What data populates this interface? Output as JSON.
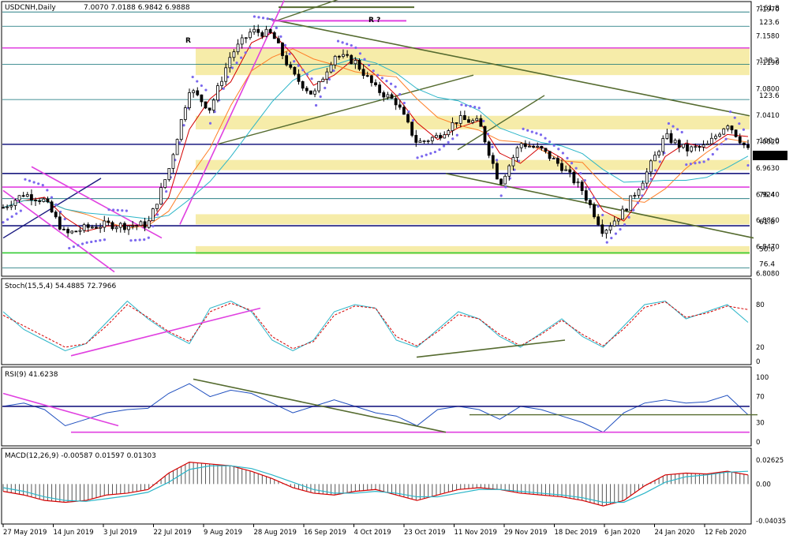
{
  "window": {
    "symbol": "USDCNH,Daily",
    "ohlc": "7.0070 7.0188 6.9842 6.9888"
  },
  "colors": {
    "background": "#ffffff",
    "candle": "#000000",
    "ma_fast": "#d40000",
    "ma_mid": "#ff7f27",
    "ma_slow": "#2bb5c8",
    "parabolic_sar": "#7b68ee",
    "zone_fill": "#f5e99a",
    "magenta": "#e040e0",
    "navy": "#1a1a80",
    "olive": "#556b2f",
    "green": "#33cc33",
    "teal": "#0a6e74",
    "annotation": "#a0522d",
    "stoch_main": "#2bb5c8",
    "stoch_signal": "#d40000",
    "rsi": "#1f4fbf",
    "macd_line": "#d40000",
    "macd_signal": "#2bb5c8",
    "macd_hist": "#555555"
  },
  "annotations": [
    "R",
    "R ?"
  ],
  "chart_data": [
    {
      "type": "candlestick",
      "title": "USDCNH,Daily",
      "ylim": [
        6.806,
        7.206
      ],
      "y_ticks": [
        "7.1970",
        "7.1580",
        "7.1190",
        "7.0800",
        "7.0410",
        "7.0020",
        "6.9630",
        "6.9240",
        "6.8860",
        "6.8470",
        "6.8080"
      ],
      "current_price": "6.9888",
      "fib_labels": [
        {
          "text": "161.8",
          "value": 7.193
        },
        {
          "text": "123.6",
          "value": 7.172
        },
        {
          "text": "138.2",
          "value": 7.116
        },
        {
          "text": "123.6",
          "value": 7.064
        },
        {
          "text": "100.0",
          "value": 6.998
        },
        {
          "text": "76.4",
          "value": 6.918
        },
        {
          "text": "61.8",
          "value": 6.878
        },
        {
          "text": "50.0",
          "value": 6.838
        },
        {
          "text": "76.4",
          "value": 6.816
        }
      ],
      "x_labels": [
        "27 May 2019",
        "14 Jun 2019",
        "3 Jul 2019",
        "22 Jul 2019",
        "9 Aug 2019",
        "28 Aug 2019",
        "16 Sep 2019",
        "4 Oct 2019",
        "23 Oct 2019",
        "11 Nov 2019",
        "29 Nov 2019",
        "18 Dec 2019",
        "6 Jan 2020",
        "24 Jan 2020",
        "12 Feb 2020"
      ],
      "close_path": [
        {
          "d": "27 May 2019",
          "c": 6.905
        },
        {
          "d": "5 Jun 2019",
          "c": 6.925
        },
        {
          "d": "14 Jun 2019",
          "c": 6.915
        },
        {
          "d": "20 Jun 2019",
          "c": 6.865
        },
        {
          "d": "25 Jun 2019",
          "c": 6.875
        },
        {
          "d": "3 Jul 2019",
          "c": 6.88
        },
        {
          "d": "12 Jul 2019",
          "c": 6.878
        },
        {
          "d": "22 Jul 2019",
          "c": 6.88
        },
        {
          "d": "2 Aug 2019",
          "c": 6.96
        },
        {
          "d": "9 Aug 2019",
          "c": 7.08
        },
        {
          "d": "16 Aug 2019",
          "c": 7.05
        },
        {
          "d": "23 Aug 2019",
          "c": 7.13
        },
        {
          "d": "28 Aug 2019",
          "c": 7.165
        },
        {
          "d": "3 Sep 2019",
          "c": 7.16
        },
        {
          "d": "9 Sep 2019",
          "c": 7.1
        },
        {
          "d": "16 Sep 2019",
          "c": 7.07
        },
        {
          "d": "25 Sep 2019",
          "c": 7.13
        },
        {
          "d": "4 Oct 2019",
          "c": 7.12
        },
        {
          "d": "14 Oct 2019",
          "c": 7.08
        },
        {
          "d": "23 Oct 2019",
          "c": 7.06
        },
        {
          "d": "31 Oct 2019",
          "c": 7.0
        },
        {
          "d": "11 Nov 2019",
          "c": 7.01
        },
        {
          "d": "20 Nov 2019",
          "c": 7.035
        },
        {
          "d": "29 Nov 2019",
          "c": 7.03
        },
        {
          "d": "3 Dec 2019",
          "c": 6.94
        },
        {
          "d": "10 Dec 2019",
          "c": 7.0
        },
        {
          "d": "18 Dec 2019",
          "c": 6.99
        },
        {
          "d": "27 Dec 2019",
          "c": 6.965
        },
        {
          "d": "6 Jan 2020",
          "c": 6.93
        },
        {
          "d": "14 Jan 2020",
          "c": 6.87
        },
        {
          "d": "20 Jan 2020",
          "c": 6.9
        },
        {
          "d": "24 Jan 2020",
          "c": 6.95
        },
        {
          "d": "3 Feb 2020",
          "c": 7.01
        },
        {
          "d": "7 Feb 2020",
          "c": 6.99
        },
        {
          "d": "12 Feb 2020",
          "c": 6.995
        },
        {
          "d": "17 Feb 2020",
          "c": 7.03
        },
        {
          "d": "21 Feb 2020",
          "c": 6.989
        }
      ]
    },
    {
      "type": "line",
      "title": "Stoch(15,5,4) 54.4885 72.7966",
      "ylim": [
        0,
        100
      ],
      "y_ticks": [
        "80",
        "20",
        "0"
      ],
      "series": [
        {
          "name": "main",
          "values": [
            70,
            45,
            30,
            15,
            25,
            55,
            85,
            60,
            40,
            25,
            75,
            85,
            70,
            30,
            15,
            30,
            70,
            80,
            75,
            30,
            20,
            45,
            70,
            60,
            35,
            20,
            40,
            60,
            35,
            20,
            50,
            80,
            85,
            60,
            70,
            80,
            55
          ]
        },
        {
          "name": "signal",
          "values": [
            65,
            50,
            35,
            20,
            25,
            50,
            80,
            62,
            42,
            28,
            70,
            82,
            72,
            35,
            18,
            28,
            65,
            78,
            75,
            35,
            22,
            42,
            66,
            60,
            38,
            22,
            38,
            58,
            38,
            22,
            46,
            76,
            84,
            62,
            68,
            78,
            73
          ]
        }
      ]
    },
    {
      "type": "line",
      "title": "RSI(9) 41.6238",
      "ylim": [
        0,
        100
      ],
      "y_ticks": [
        "100",
        "70",
        "30",
        "0"
      ],
      "series": [
        {
          "name": "rsi",
          "values": [
            55,
            60,
            50,
            25,
            35,
            45,
            50,
            52,
            75,
            90,
            70,
            80,
            75,
            60,
            45,
            55,
            65,
            55,
            45,
            40,
            25,
            50,
            55,
            50,
            35,
            55,
            50,
            40,
            30,
            15,
            45,
            60,
            65,
            60,
            62,
            72,
            42
          ]
        }
      ]
    },
    {
      "type": "bar",
      "title": "MACD(12,26,9) -0.00587 0.01597 0.01303",
      "ylim": [
        -0.04035,
        0.02625
      ],
      "y_ticks": [
        "0.02625",
        "0.00",
        "-0.04035"
      ],
      "series": [
        {
          "name": "macd",
          "values": [
            -0.008,
            -0.012,
            -0.018,
            -0.02,
            -0.018,
            -0.012,
            -0.01,
            -0.006,
            0.012,
            0.024,
            0.022,
            0.02,
            0.014,
            0.006,
            -0.004,
            -0.01,
            -0.012,
            -0.008,
            -0.006,
            -0.012,
            -0.018,
            -0.012,
            -0.006,
            -0.004,
            -0.006,
            -0.01,
            -0.012,
            -0.014,
            -0.018,
            -0.024,
            -0.018,
            -0.002,
            0.01,
            0.012,
            0.011,
            0.014,
            0.01
          ]
        },
        {
          "name": "signal",
          "values": [
            -0.004,
            -0.008,
            -0.014,
            -0.018,
            -0.019,
            -0.016,
            -0.013,
            -0.009,
            0.002,
            0.016,
            0.02,
            0.02,
            0.017,
            0.01,
            0.002,
            -0.006,
            -0.01,
            -0.01,
            -0.008,
            -0.01,
            -0.014,
            -0.014,
            -0.01,
            -0.006,
            -0.006,
            -0.008,
            -0.01,
            -0.012,
            -0.015,
            -0.02,
            -0.02,
            -0.01,
            0.002,
            0.008,
            0.01,
            0.013,
            0.014
          ]
        }
      ]
    }
  ]
}
